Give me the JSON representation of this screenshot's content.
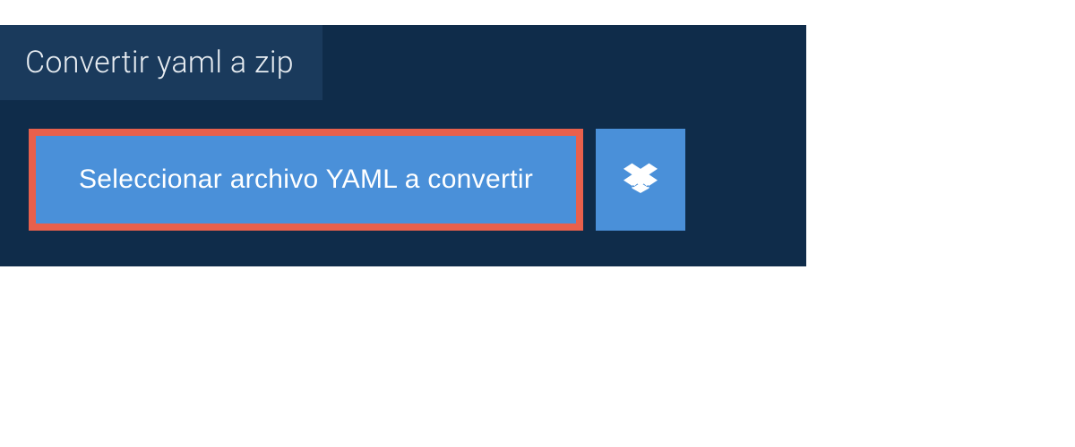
{
  "tab": {
    "title": "Convertir yaml a zip"
  },
  "upload": {
    "select_label": "Seleccionar archivo YAML a convertir"
  }
}
